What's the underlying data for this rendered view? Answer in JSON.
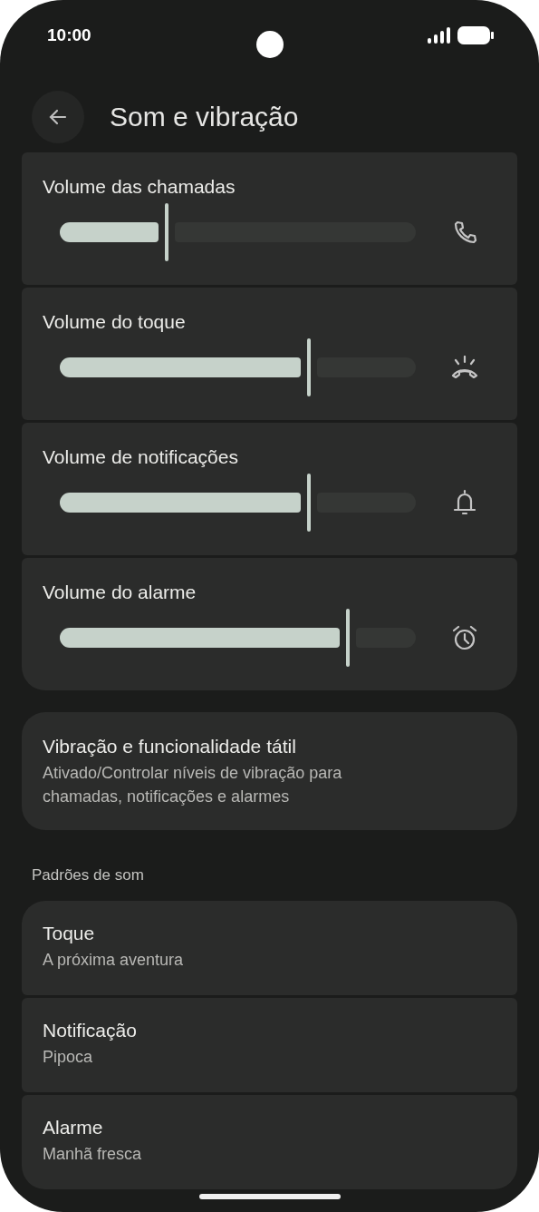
{
  "status_bar": {
    "time": "10:00"
  },
  "header": {
    "title": "Som e vibração"
  },
  "volumes": [
    {
      "label": "Volume das chamadas",
      "level": 0.3,
      "kind": "call"
    },
    {
      "label": "Volume do toque",
      "level": 0.7,
      "kind": "ring"
    },
    {
      "label": "Volume de notificações",
      "level": 0.7,
      "kind": "notification"
    },
    {
      "label": "Volume do alarme",
      "level": 0.81,
      "kind": "alarm"
    }
  ],
  "vibration": {
    "title": "Vibração e funcionalidade tátil",
    "subtitle": "Ativado/Controlar níveis de vibração para chamadas, notificações e alarmes"
  },
  "section_title": "Padrões de som",
  "sounds": [
    {
      "title": "Toque",
      "subtitle": "A próxima aventura"
    },
    {
      "title": "Notificação",
      "subtitle": "Pipoca"
    },
    {
      "title": "Alarme",
      "subtitle": "Manhã fresca"
    }
  ]
}
